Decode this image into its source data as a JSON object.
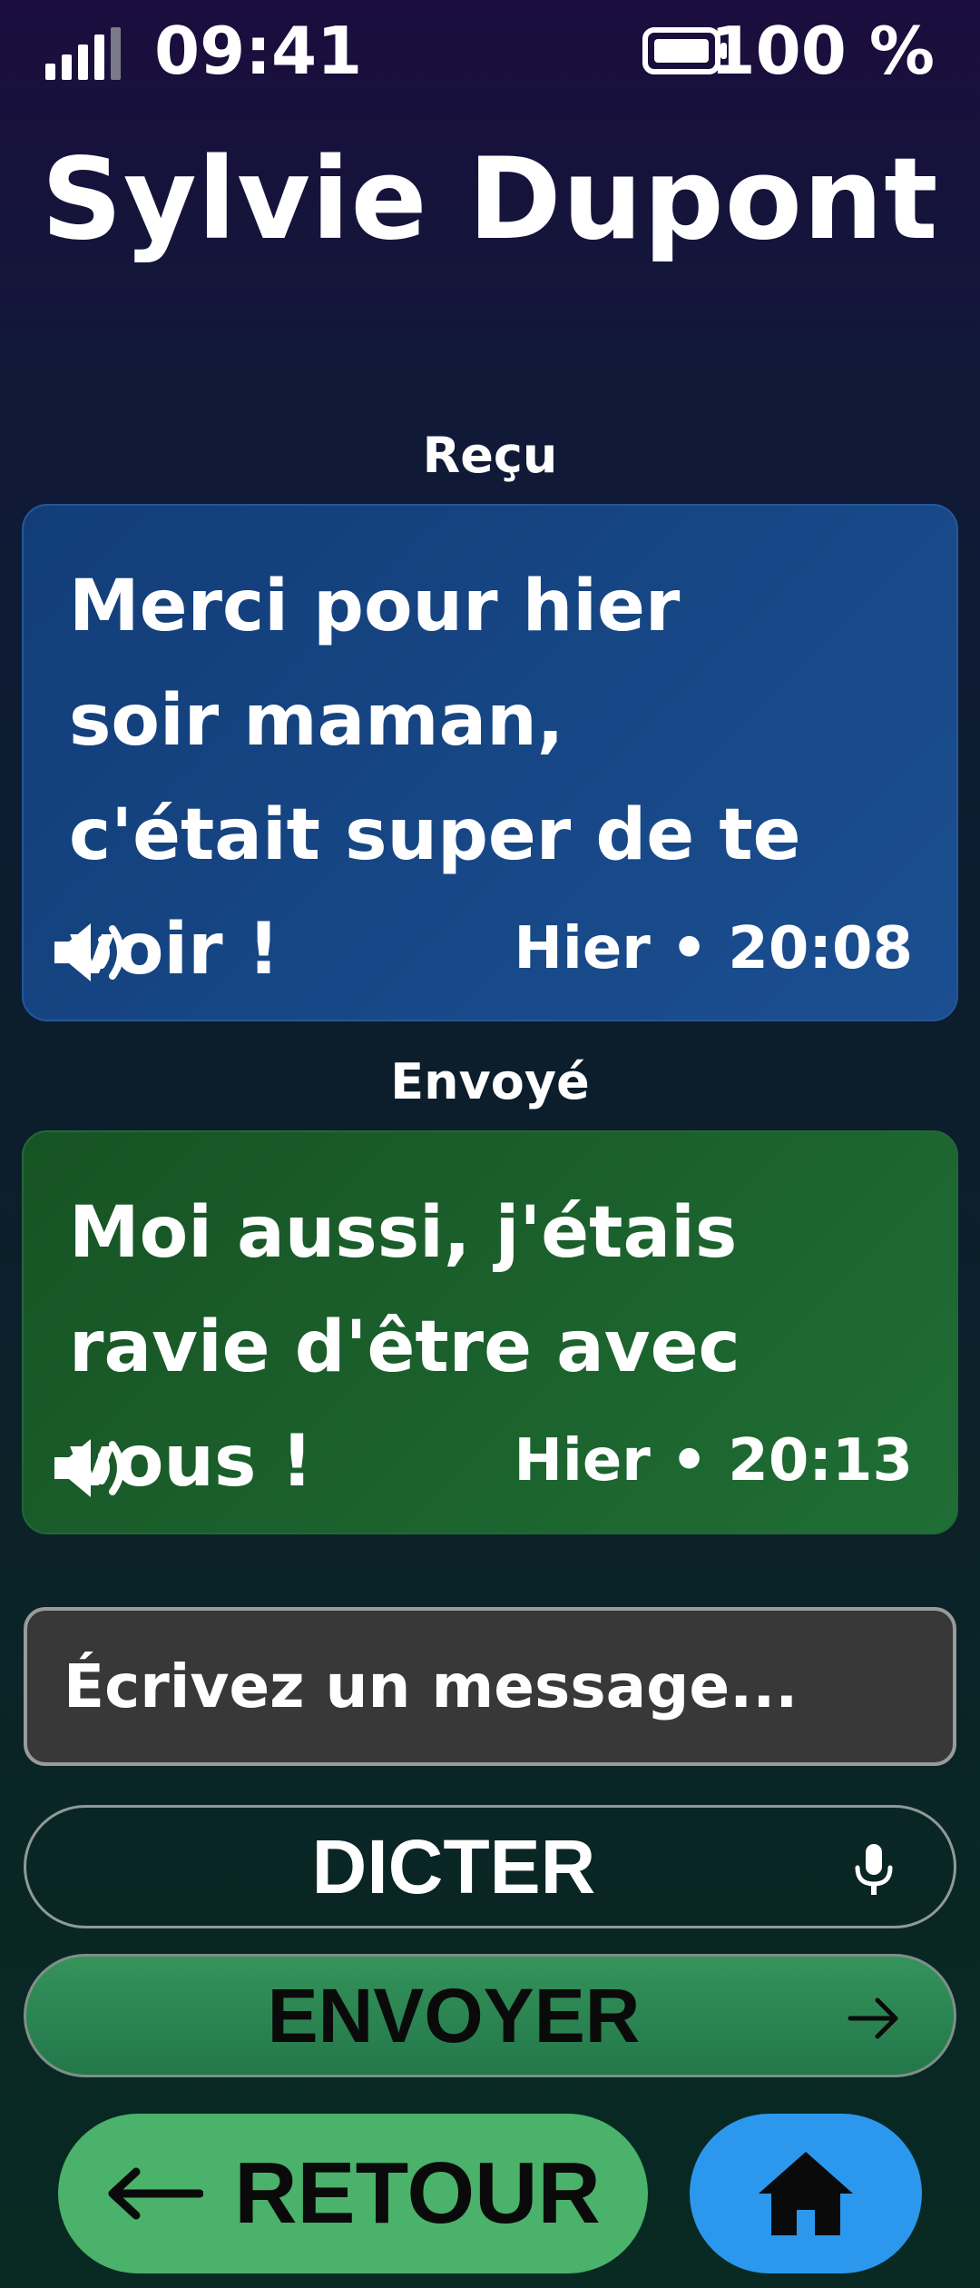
{
  "status_bar": {
    "time": "09:41",
    "battery_percent": "100 %",
    "signal_icon": "signal-bars-icon",
    "battery_icon": "battery-full-icon"
  },
  "contact": {
    "name": "Sylvie Dupont"
  },
  "messages": [
    {
      "direction_label": "Reçu",
      "text": "Merci pour hier soir maman, c'était super de te voir !",
      "time": "Hier • 20:08",
      "speaker_icon": "speaker-icon",
      "color": "#1a4a8a"
    },
    {
      "direction_label": "Envoyé",
      "text": "Moi aussi, j'étais ravie d'être avec vous !",
      "time": "Hier • 20:13",
      "speaker_icon": "speaker-icon",
      "color": "#1e6a32"
    }
  ],
  "compose": {
    "placeholder": "Écrivez un message..."
  },
  "actions": {
    "dictate_label": "DICTER",
    "dictate_icon": "microphone-icon",
    "send_label": "ENVOYER",
    "send_icon": "arrow-right-icon",
    "back_label": "RETOUR",
    "back_icon": "arrow-left-icon",
    "home_icon": "home-icon"
  },
  "colors": {
    "received_bubble": "#1a4a8a",
    "sent_bubble": "#1e6a32",
    "back_button": "#4ab26a",
    "home_button": "#2b98ee",
    "send_button": "#2e8a52"
  }
}
